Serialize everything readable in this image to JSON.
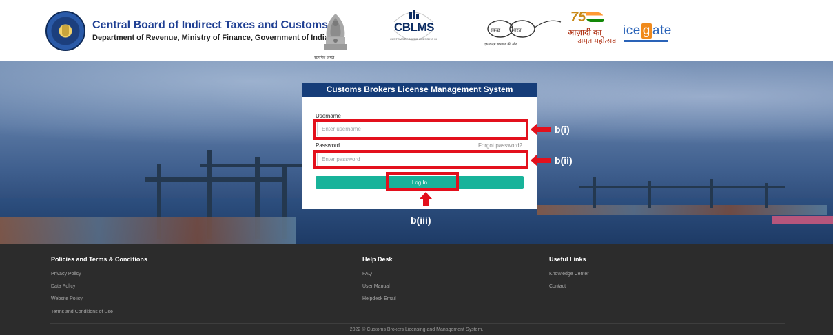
{
  "header": {
    "org_title": "Central Board of Indirect Taxes and Customs",
    "org_subtitle": "Department of Revenue, Ministry of Finance, Government of India",
    "emblem_caption": "सत्यमेव जयते",
    "cblms_text": "CBLMS",
    "cblms_tagline": "CUSTOMS BROKERS LICENSING MANAGEMENT SYSTEM",
    "swachh_word_1": "स्वच्छ",
    "swachh_word_2": "भारत",
    "swachh_caption": "एक कदम स्वच्छता की ओर",
    "azadi_number": "75",
    "azadi_line_1": "आज़ादी का",
    "azadi_line_2": "अमृत महोत्सव",
    "icegate_pre": "ice",
    "icegate_box_1": "g",
    "icegate_mid": "ate"
  },
  "login": {
    "title": "Customs Brokers License Management System",
    "username_label": "Username",
    "username_placeholder": "Enter username",
    "password_label": "Password",
    "password_placeholder": "Enter password",
    "forgot_password": "Forgot password?",
    "login_button": "Log In"
  },
  "annotations": {
    "username": "b(i)",
    "password": "b(ii)",
    "login": "b(iii)",
    "highlight_color": "#e3101c"
  },
  "footer": {
    "col1_heading": "Policies and Terms & Conditions",
    "col1_links": [
      "Privacy Policy",
      "Data Policy",
      "Website Policy",
      "Terms and Conditions of Use"
    ],
    "col2_heading": "Help Desk",
    "col2_links": [
      "FAQ",
      "User Manual",
      "Helpdesk Email"
    ],
    "col3_heading": "Useful Links",
    "col3_links": [
      "Knowledge Center",
      "Contact"
    ],
    "copyright": "2022 © Customs Brokers Licensing and Management System."
  },
  "colors": {
    "brand_blue": "#163d79",
    "login_button": "#18b39a",
    "footer_bg": "#2c2c2c"
  }
}
